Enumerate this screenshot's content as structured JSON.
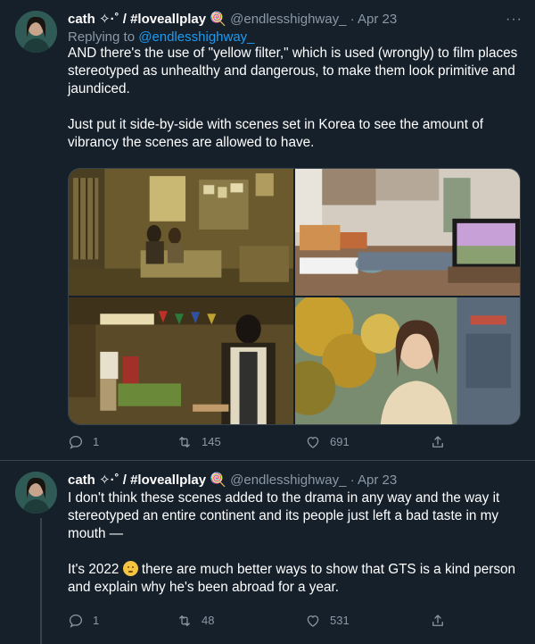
{
  "tweets": [
    {
      "name": "cath ✧·˚ / #loveallplay 🍭",
      "handle": "@endlesshighway_",
      "dot": "·",
      "date": "Apr 23",
      "more": "···",
      "replying_prefix": "Replying to ",
      "replying_to": "@endlesshighway_",
      "text": "AND there's the use of \"yellow filter,\" which is used (wrongly) to film places stereotyped as unhealthy and dangerous, to make them look primitive and jaundiced.\n\nJust put it side-by-side with scenes set in Korea to see the amount of vibrancy the scenes are allowed to have.",
      "media": [
        "yellow-tinted room scene",
        "bright modern apartment scene",
        "yellow-tinted street market scene",
        "bright outdoor scene with trees"
      ],
      "replies": "1",
      "retweets": "145",
      "likes": "691"
    },
    {
      "name": "cath ✧·˚ / #loveallplay 🍭",
      "handle": "@endlesshighway_",
      "dot": "·",
      "date": "Apr 23",
      "text_part1": "I don't think these scenes added to the drama in any way and the way it stereotyped an entire continent and its people just left a bad taste in my mouth —\n\nIt's 2022 ",
      "text_part2": " there are much better ways to show that GTS is a kind person and explain why he's been abroad for a year.",
      "replies": "1",
      "retweets": "48",
      "likes": "531"
    }
  ],
  "icons": {
    "reply": "reply-icon",
    "retweet": "retweet-icon",
    "like": "heart-icon",
    "share": "share-icon",
    "emoji": "grimacing-face-emoji"
  },
  "colors": {
    "background": "#15202b",
    "text": "#ffffff",
    "muted": "#8b98a5",
    "link": "#1d9bf0",
    "border": "#38444d"
  }
}
